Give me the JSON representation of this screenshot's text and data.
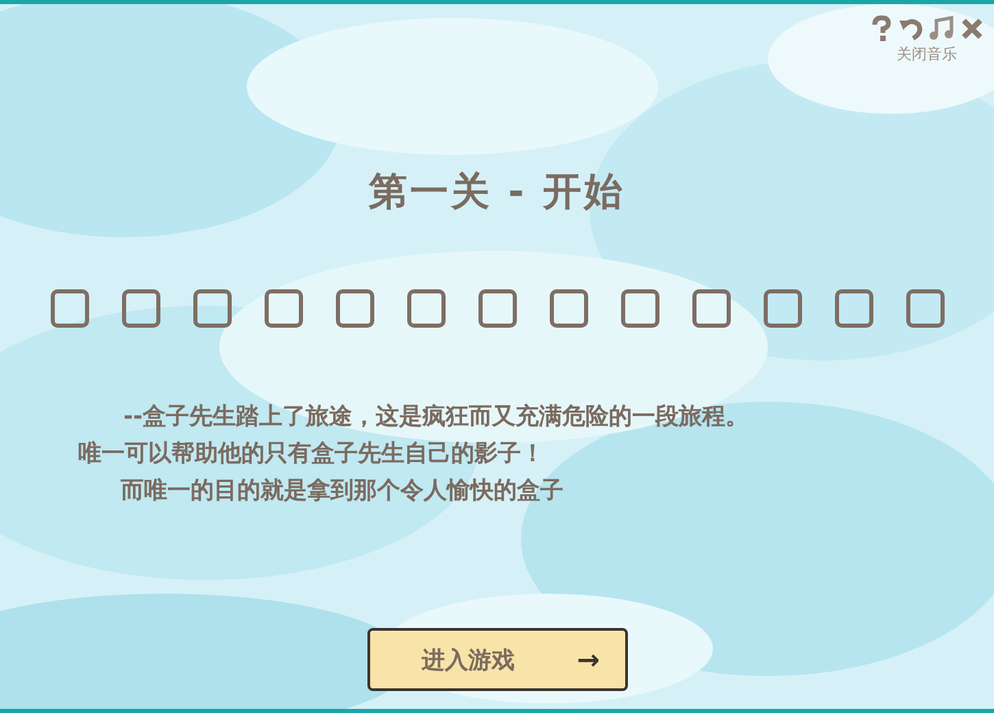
{
  "toolbar": {
    "music_label": "关闭音乐"
  },
  "title": "第一关 - 开始",
  "slots": [
    {
      "filled": false
    },
    {
      "filled": false
    },
    {
      "filled": false
    },
    {
      "filled": false
    },
    {
      "filled": false
    },
    {
      "filled": false
    },
    {
      "filled": false
    },
    {
      "filled": false
    },
    {
      "filled": false
    },
    {
      "filled": false
    },
    {
      "filled": false
    },
    {
      "filled": false
    },
    {
      "filled": false
    }
  ],
  "story": [
    "--盒子先生踏上了旅途，这是疯狂而又充满危险的一段旅程。",
    "唯一可以帮助他的只有盒子先生自己的影子！",
    "而唯一的目的就是拿到那个令人愉快的盒子"
  ],
  "start_button": {
    "label": "进入游戏",
    "arrow": "→"
  }
}
